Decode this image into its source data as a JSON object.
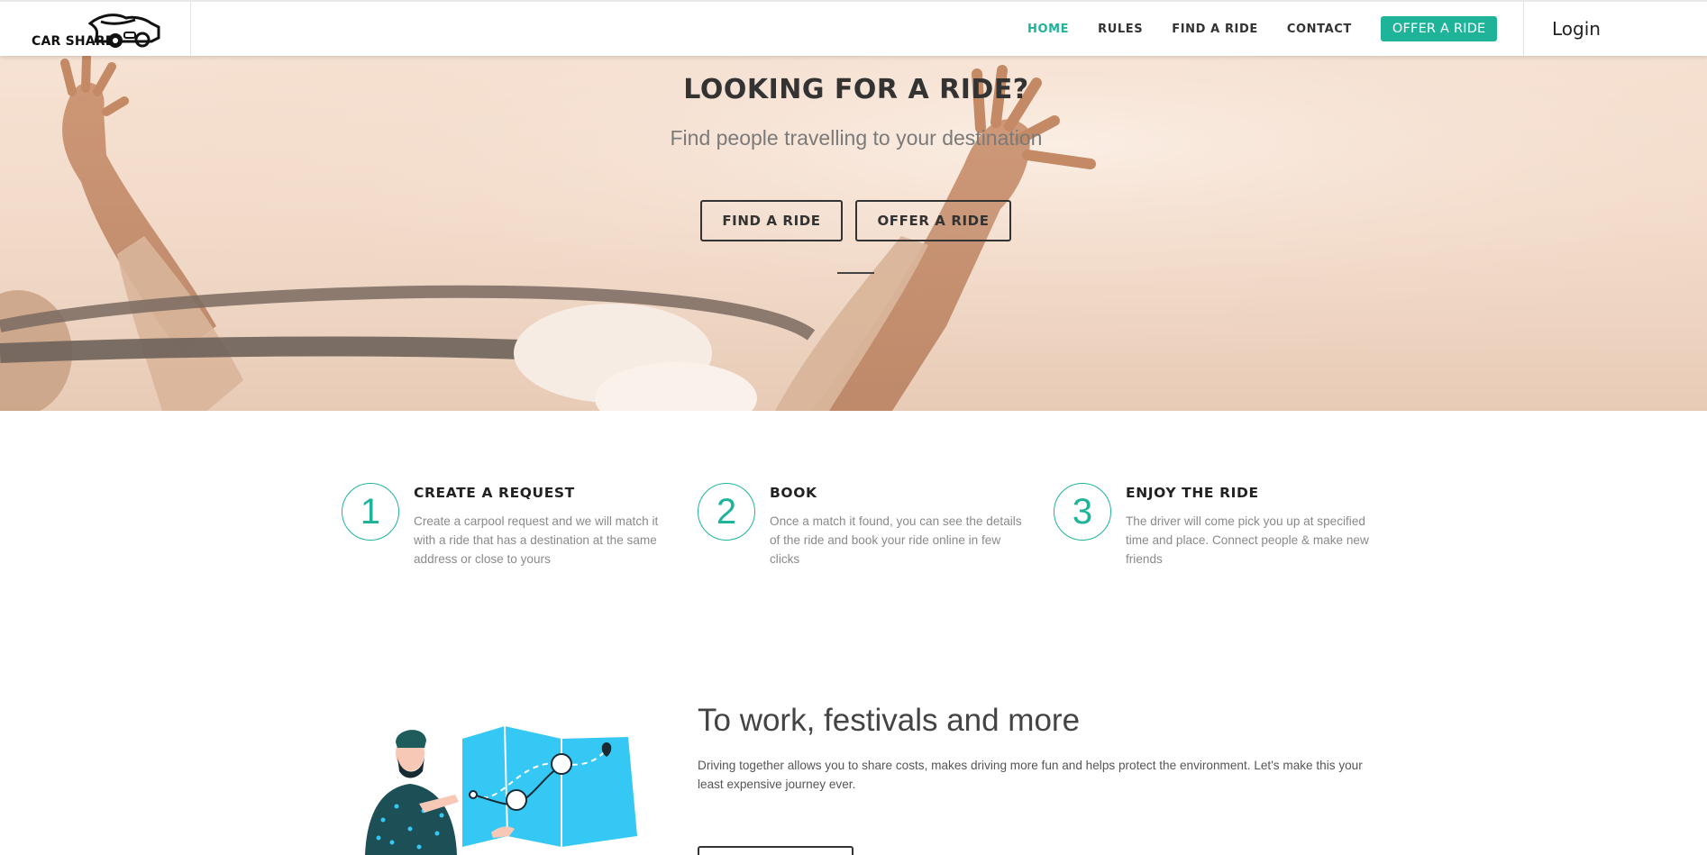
{
  "brand": {
    "name": "CAR SHARE"
  },
  "nav": {
    "items": [
      {
        "label": "HOME",
        "active": true
      },
      {
        "label": "RULES",
        "active": false
      },
      {
        "label": "FIND A RIDE",
        "active": false
      },
      {
        "label": "CONTACT",
        "active": false
      }
    ],
    "cta_label": "OFFER A RIDE",
    "login_label": "Login"
  },
  "hero": {
    "title": "LOOKING FOR A RIDE?",
    "subtitle": "Find people travelling to your destination",
    "find_button": "FIND A RIDE",
    "offer_button": "OFFER A RIDE"
  },
  "steps": [
    {
      "number": "1",
      "title": "CREATE A REQUEST",
      "description": "Create a carpool request and we will match it with a ride that has a destination at the same address or close to yours"
    },
    {
      "number": "2",
      "title": "BOOK",
      "description": "Once a match it found, you can see the details of the ride and book your ride online in few clicks"
    },
    {
      "number": "3",
      "title": "ENJOY THE RIDE",
      "description": "The driver will come pick you up at specified time and place. Connect people & make new friends"
    }
  ],
  "feature": {
    "title": "To work, festivals and more",
    "description": "Driving together allows you to share costs, makes driving more fun and helps protect the environment. Let's make this your least expensive journey ever."
  },
  "colors": {
    "accent": "#1fb49a",
    "text_dark": "#333333",
    "text_muted": "#8a8a8a",
    "map_blue": "#35c8f4"
  },
  "icons": [
    "car-logo-icon",
    "person-with-map-illustration"
  ]
}
